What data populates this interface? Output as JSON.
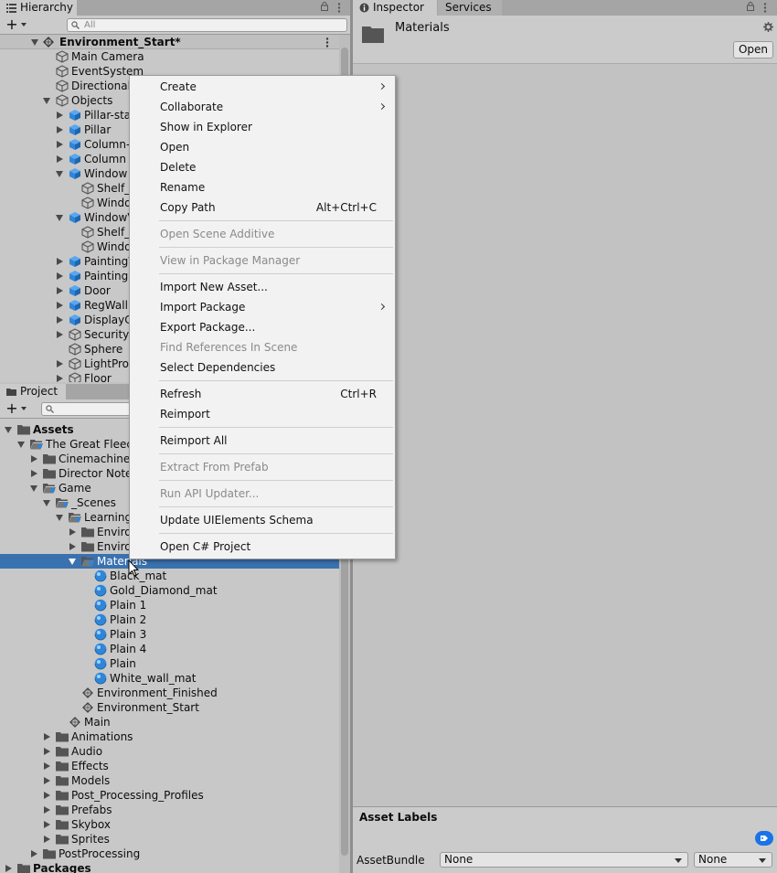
{
  "hierarchy": {
    "tab_label": "Hierarchy",
    "search_placeholder": "All",
    "scene_name": "Environment_Start*",
    "items": [
      {
        "label": "Main Camera",
        "depth": 2,
        "expand": "none",
        "icon": "gameobject-outline-icon"
      },
      {
        "label": "EventSystem",
        "depth": 2,
        "expand": "none",
        "icon": "gameobject-outline-icon"
      },
      {
        "label": "Directional",
        "depth": 2,
        "expand": "none",
        "icon": "gameobject-outline-icon"
      },
      {
        "label": "Objects",
        "depth": 2,
        "expand": "open",
        "icon": "gameobject-outline-icon"
      },
      {
        "label": "Pillar-sta",
        "depth": 3,
        "expand": "closed",
        "icon": "prefab-cube-icon"
      },
      {
        "label": "Pillar",
        "depth": 3,
        "expand": "closed",
        "icon": "prefab-cube-icon"
      },
      {
        "label": "Column-",
        "depth": 3,
        "expand": "closed",
        "icon": "prefab-cube-icon"
      },
      {
        "label": "Column",
        "depth": 3,
        "expand": "closed",
        "icon": "prefab-cube-icon"
      },
      {
        "label": "Window",
        "depth": 3,
        "expand": "open",
        "icon": "prefab-cube-icon"
      },
      {
        "label": "Shelf_",
        "depth": 4,
        "expand": "none",
        "icon": "gameobject-outline-icon"
      },
      {
        "label": "Windo",
        "depth": 4,
        "expand": "none",
        "icon": "gameobject-outline-icon"
      },
      {
        "label": "WindowV",
        "depth": 3,
        "expand": "open",
        "icon": "prefab-cube-icon"
      },
      {
        "label": "Shelf_",
        "depth": 4,
        "expand": "none",
        "icon": "gameobject-outline-icon"
      },
      {
        "label": "Windo",
        "depth": 4,
        "expand": "none",
        "icon": "gameobject-outline-icon"
      },
      {
        "label": "PaintingV",
        "depth": 3,
        "expand": "closed",
        "icon": "prefab-cube-icon"
      },
      {
        "label": "Painting",
        "depth": 3,
        "expand": "closed",
        "icon": "prefab-cube-icon"
      },
      {
        "label": "Door",
        "depth": 3,
        "expand": "closed",
        "icon": "prefab-cube-icon"
      },
      {
        "label": "RegWall",
        "depth": 3,
        "expand": "closed",
        "icon": "prefab-cube-icon"
      },
      {
        "label": "DisplayC",
        "depth": 3,
        "expand": "closed",
        "icon": "prefab-cube-icon"
      },
      {
        "label": "Security",
        "depth": 3,
        "expand": "closed",
        "icon": "gameobject-outline-icon"
      },
      {
        "label": "Sphere",
        "depth": 3,
        "expand": "none",
        "icon": "gameobject-outline-icon"
      },
      {
        "label": "LightPro",
        "depth": 3,
        "expand": "closed",
        "icon": "gameobject-outline-icon"
      },
      {
        "label": "Floor",
        "depth": 3,
        "expand": "closed",
        "icon": "gameobject-outline-icon"
      }
    ]
  },
  "project": {
    "tab_label": "Project",
    "items": [
      {
        "label": "Assets",
        "depth": 0,
        "expand": "open",
        "icon": "folder-icon",
        "bold": true
      },
      {
        "label": "The Great Fleece",
        "depth": 1,
        "expand": "open",
        "icon": "folder-open-icon"
      },
      {
        "label": "Cinemachine",
        "depth": 2,
        "expand": "closed",
        "icon": "folder-icon"
      },
      {
        "label": "Director Notes",
        "depth": 2,
        "expand": "closed",
        "icon": "folder-icon"
      },
      {
        "label": "Game",
        "depth": 2,
        "expand": "open",
        "icon": "folder-open-icon"
      },
      {
        "label": "_Scenes",
        "depth": 3,
        "expand": "open",
        "icon": "folder-open-icon"
      },
      {
        "label": "Learning",
        "depth": 4,
        "expand": "open",
        "icon": "folder-open-icon"
      },
      {
        "label": "Enviro",
        "depth": 5,
        "expand": "closed",
        "icon": "folder-icon"
      },
      {
        "label": "Enviro",
        "depth": 5,
        "expand": "closed",
        "icon": "folder-icon"
      },
      {
        "label": "Materials",
        "depth": 5,
        "expand": "open",
        "icon": "folder-open-icon",
        "selected": true
      },
      {
        "label": "Black_mat",
        "depth": 6,
        "expand": "none",
        "icon": "material-icon"
      },
      {
        "label": "Gold_Diamond_mat",
        "depth": 6,
        "expand": "none",
        "icon": "material-icon"
      },
      {
        "label": "Plain 1",
        "depth": 6,
        "expand": "none",
        "icon": "material-icon"
      },
      {
        "label": "Plain 2",
        "depth": 6,
        "expand": "none",
        "icon": "material-icon"
      },
      {
        "label": "Plain 3",
        "depth": 6,
        "expand": "none",
        "icon": "material-icon"
      },
      {
        "label": "Plain 4",
        "depth": 6,
        "expand": "none",
        "icon": "material-icon"
      },
      {
        "label": "Plain",
        "depth": 6,
        "expand": "none",
        "icon": "material-icon"
      },
      {
        "label": "White_wall_mat",
        "depth": 6,
        "expand": "none",
        "icon": "material-icon"
      },
      {
        "label": "Environment_Finished",
        "depth": 5,
        "expand": "none",
        "icon": "scene-icon"
      },
      {
        "label": "Environment_Start",
        "depth": 5,
        "expand": "none",
        "icon": "scene-icon"
      },
      {
        "label": "Main",
        "depth": 4,
        "expand": "none",
        "icon": "scene-icon"
      },
      {
        "label": "Animations",
        "depth": 3,
        "expand": "closed",
        "icon": "folder-icon"
      },
      {
        "label": "Audio",
        "depth": 3,
        "expand": "closed",
        "icon": "folder-icon"
      },
      {
        "label": "Effects",
        "depth": 3,
        "expand": "closed",
        "icon": "folder-icon"
      },
      {
        "label": "Models",
        "depth": 3,
        "expand": "closed",
        "icon": "folder-icon"
      },
      {
        "label": "Post_Processing_Profiles",
        "depth": 3,
        "expand": "closed",
        "icon": "folder-icon"
      },
      {
        "label": "Prefabs",
        "depth": 3,
        "expand": "closed",
        "icon": "folder-icon"
      },
      {
        "label": "Skybox",
        "depth": 3,
        "expand": "closed",
        "icon": "folder-icon"
      },
      {
        "label": "Sprites",
        "depth": 3,
        "expand": "closed",
        "icon": "folder-icon"
      },
      {
        "label": "PostProcessing",
        "depth": 2,
        "expand": "closed",
        "icon": "folder-icon"
      },
      {
        "label": "Packages",
        "depth": 0,
        "expand": "closed",
        "icon": "folder-icon",
        "bold": true
      }
    ]
  },
  "inspector": {
    "tab_label": "Inspector",
    "services_label": "Services",
    "title": "Materials",
    "open_button": "Open",
    "asset_labels": "Asset Labels",
    "assetbundle_label": "AssetBundle",
    "assetbundle_value": "None",
    "variant_value": "None"
  },
  "context_menu": {
    "items": [
      {
        "type": "item",
        "label": "Create",
        "submenu": true
      },
      {
        "type": "item",
        "label": "Collaborate",
        "submenu": true
      },
      {
        "type": "item",
        "label": "Show in Explorer"
      },
      {
        "type": "item",
        "label": "Open"
      },
      {
        "type": "item",
        "label": "Delete"
      },
      {
        "type": "item",
        "label": "Rename"
      },
      {
        "type": "item",
        "label": "Copy Path",
        "shortcut": "Alt+Ctrl+C"
      },
      {
        "type": "sep"
      },
      {
        "type": "item",
        "label": "Open Scene Additive",
        "disabled": true
      },
      {
        "type": "sep"
      },
      {
        "type": "item",
        "label": "View in Package Manager",
        "disabled": true
      },
      {
        "type": "sep"
      },
      {
        "type": "item",
        "label": "Import New Asset..."
      },
      {
        "type": "item",
        "label": "Import Package",
        "submenu": true
      },
      {
        "type": "item",
        "label": "Export Package..."
      },
      {
        "type": "item",
        "label": "Find References In Scene",
        "disabled": true
      },
      {
        "type": "item",
        "label": "Select Dependencies"
      },
      {
        "type": "sep"
      },
      {
        "type": "item",
        "label": "Refresh",
        "shortcut": "Ctrl+R"
      },
      {
        "type": "item",
        "label": "Reimport"
      },
      {
        "type": "sep"
      },
      {
        "type": "item",
        "label": "Reimport All"
      },
      {
        "type": "sep"
      },
      {
        "type": "item",
        "label": "Extract From Prefab",
        "disabled": true
      },
      {
        "type": "sep"
      },
      {
        "type": "item",
        "label": "Run API Updater...",
        "disabled": true
      },
      {
        "type": "sep"
      },
      {
        "type": "item",
        "label": "Update UIElements Schema"
      },
      {
        "type": "sep"
      },
      {
        "type": "item",
        "label": "Open C# Project"
      }
    ]
  },
  "colors": {
    "selection": "#3a72b0",
    "prefab_blue": "#2f86d8",
    "tag_blue": "#1a73e8"
  }
}
